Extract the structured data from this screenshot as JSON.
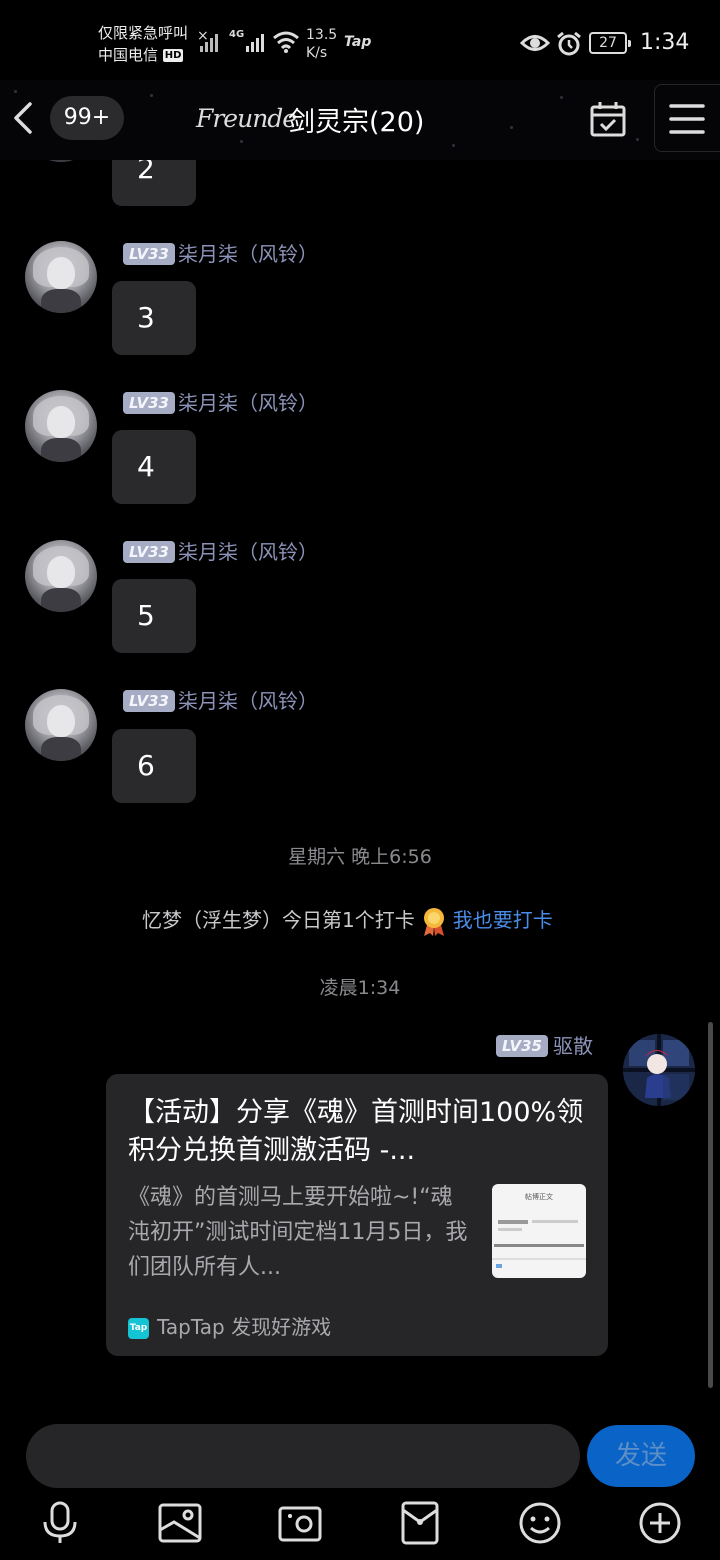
{
  "status_bar": {
    "carrier_line1": "仅限紧急呼叫",
    "carrier_line2": "中国电信",
    "hd_badge": "HD",
    "net_type": "4G",
    "speed_value": "13.5",
    "speed_unit": "K/s",
    "app_tag": "Tap",
    "battery": "27",
    "time": "1:34"
  },
  "header": {
    "unread": "99+",
    "logo_text": "Freunde",
    "title": "剑灵宗(20)"
  },
  "messages": [
    {
      "level": "",
      "name": "",
      "text": "2"
    },
    {
      "level": "LV33",
      "name": "柒月柒（风铃）",
      "text": "3"
    },
    {
      "level": "LV33",
      "name": "柒月柒（风铃）",
      "text": "4"
    },
    {
      "level": "LV33",
      "name": "柒月柒（风铃）",
      "text": "5"
    },
    {
      "level": "LV33",
      "name": "柒月柒（风铃）",
      "text": "6"
    }
  ],
  "timestamp_1": "星期六 晚上6:56",
  "checkin": {
    "text": "忆梦（浮生梦）今日第1个打卡",
    "link": "我也要打卡"
  },
  "timestamp_2": "凌晨1:34",
  "my_message": {
    "level": "LV35",
    "name": "驱散",
    "card": {
      "title": "【活动】分享《魂》首测时间100%领积分兑换首测激活码 -...",
      "description": "《魂》的首测马上要开始啦~!“魂沌初开”测试时间定档11月5日，我们团队所有人...",
      "thumb_label": "帖博正文",
      "source_icon": "Tap",
      "source": "TapTap 发现好游戏"
    }
  },
  "composer": {
    "input_value": "",
    "send_label": "发送"
  },
  "toolbar": [
    "mic-icon",
    "image-icon",
    "camera-icon",
    "red-packet-icon",
    "emoji-icon",
    "plus-icon"
  ],
  "colors": {
    "accent": "#0a63c6",
    "link": "#4a8de8",
    "username": "#8c93b8",
    "bubble": "#2a2a2c",
    "level_badge": "#a5acc4"
  }
}
